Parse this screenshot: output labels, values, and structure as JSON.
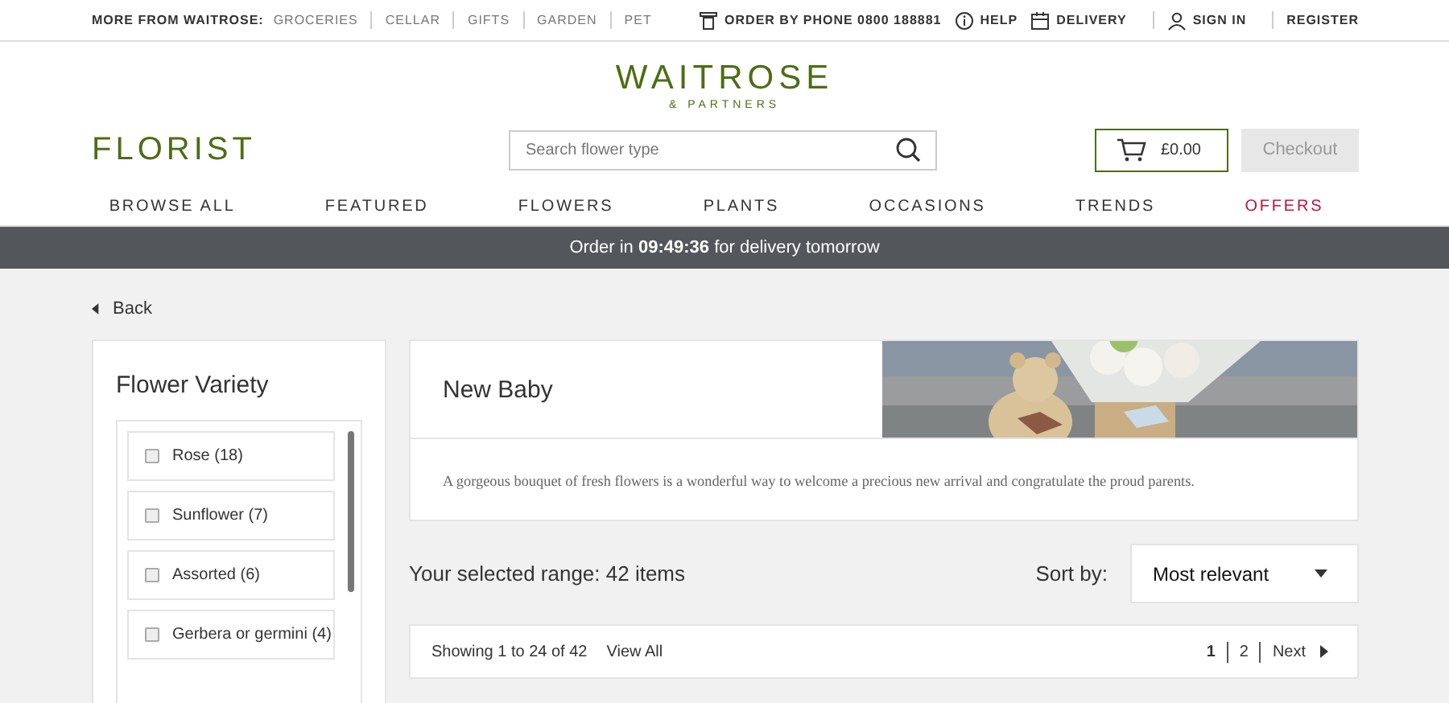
{
  "top_bar": {
    "more_label": "MORE FROM WAITROSE:",
    "more_links": [
      "GROCERIES",
      "CELLAR",
      "GIFTS",
      "GARDEN",
      "PET"
    ],
    "utility_links": [
      {
        "kind": "phone",
        "label": "ORDER BY PHONE 0800 188881"
      },
      {
        "kind": "help",
        "label": "HELP"
      },
      {
        "kind": "delivery",
        "label": "DELIVERY"
      },
      {
        "kind": "user",
        "label": "SIGN IN"
      },
      {
        "kind": "plain",
        "label": "REGISTER"
      }
    ]
  },
  "logo": {
    "name": "WAITROSE",
    "sub": "& PARTNERS"
  },
  "section_title": "FLORIST",
  "search": {
    "placeholder": "Search flower type"
  },
  "basket": {
    "total": "£0.00"
  },
  "checkout": {
    "label": "Checkout",
    "disabled": true
  },
  "nav": [
    {
      "label": "BROWSE ALL",
      "highlight": false
    },
    {
      "label": "FEATURED",
      "highlight": false
    },
    {
      "label": "FLOWERS",
      "highlight": false
    },
    {
      "label": "PLANTS",
      "highlight": false
    },
    {
      "label": "OCCASIONS",
      "highlight": false
    },
    {
      "label": "TRENDS",
      "highlight": false
    },
    {
      "label": "OFFERS",
      "highlight": true
    }
  ],
  "banner": "Order in **09:49:36** for delivery tomorrow",
  "back": "Back",
  "filter": {
    "title": "Flower Variety",
    "options": [
      {
        "label": "Rose (18)",
        "checked": false
      },
      {
        "label": "Sunflower (7)",
        "checked": false
      },
      {
        "label": "Assorted (6)",
        "checked": false
      },
      {
        "label": "Gerbera or germini (4)",
        "checked": false
      }
    ]
  },
  "category": {
    "title": "New Baby",
    "description": "A gorgeous bouquet of fresh flowers is a wonderful way to welcome a precious new arrival and congratulate the proud parents."
  },
  "results": {
    "summary": "Your selected range: 42 items",
    "sort_label": "Sort by:",
    "sort_value": "Most relevant"
  },
  "pagination": {
    "showing": "Showing  1 to 24 of 42",
    "view_all": "View All",
    "pages": [
      {
        "label": "1",
        "selected": true
      },
      {
        "label": "2",
        "selected": false
      }
    ],
    "next": "Next"
  }
}
